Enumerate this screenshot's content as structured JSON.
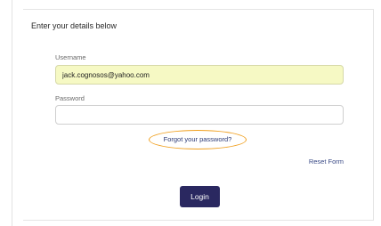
{
  "form": {
    "heading": "Enter your details below",
    "username_label": "Username",
    "username_value": "jack.cognosos@yahoo.com",
    "password_label": "Password",
    "password_value": "",
    "forgot_link": "Forgot your password?",
    "reset_link": "Reset Form",
    "login_button": "Login"
  },
  "colors": {
    "username_field_bg": "#f6f9c4",
    "highlight_ring": "#f0a020",
    "login_button_bg": "#2a2860",
    "link_color": "#2c3a75"
  }
}
